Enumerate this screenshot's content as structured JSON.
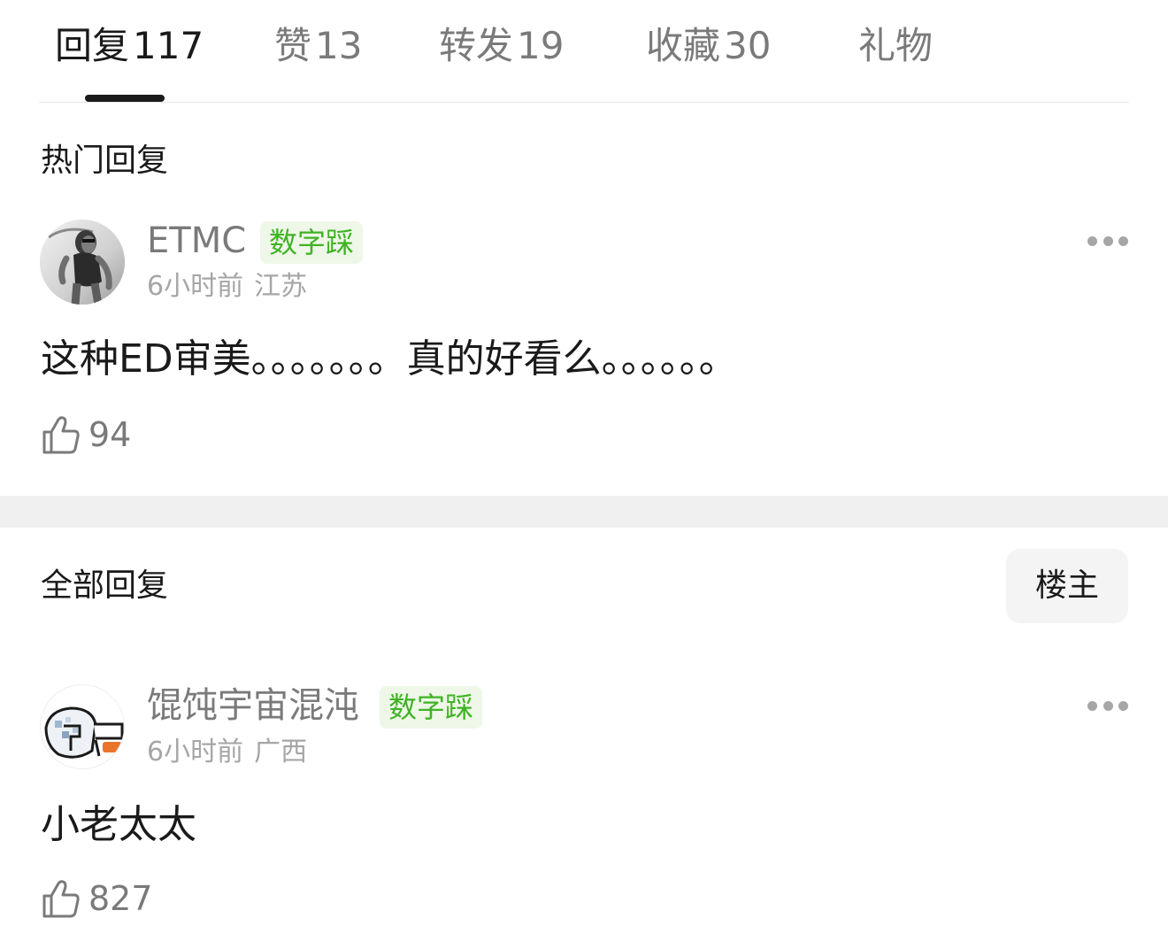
{
  "tabs": [
    {
      "label": "回复",
      "count": "117",
      "active": true
    },
    {
      "label": "赞",
      "count": "13"
    },
    {
      "label": "转发",
      "count": "19"
    },
    {
      "label": "收藏",
      "count": "30"
    },
    {
      "label": "礼物",
      "count": ""
    }
  ],
  "hot_section": {
    "title": "热门回复",
    "comments": [
      {
        "username": "ETMC",
        "badge": "数字踩",
        "time": "6小时前",
        "location": "江苏",
        "text": "这种ED审美。。。。。。。真的好看么。。。。。。",
        "likes": "94",
        "avatar_icon": "user-photo-avatar-icon"
      }
    ]
  },
  "all_section": {
    "title": "全部回复",
    "filter_button": "楼主",
    "comments": [
      {
        "username": "馄饨宇宙混沌",
        "badge": "数字踩",
        "time": "6小时前",
        "location": "广西",
        "text": "小老太太",
        "likes": "827",
        "avatar_icon": "pixel-art-avatar-icon"
      }
    ]
  },
  "colors": {
    "badge_text": "#3fb323",
    "badge_bg": "#eef7e8",
    "muted_text": "#7a7a7a",
    "meta_text": "#a6a6a6",
    "section_band": "#f0f0f0"
  }
}
